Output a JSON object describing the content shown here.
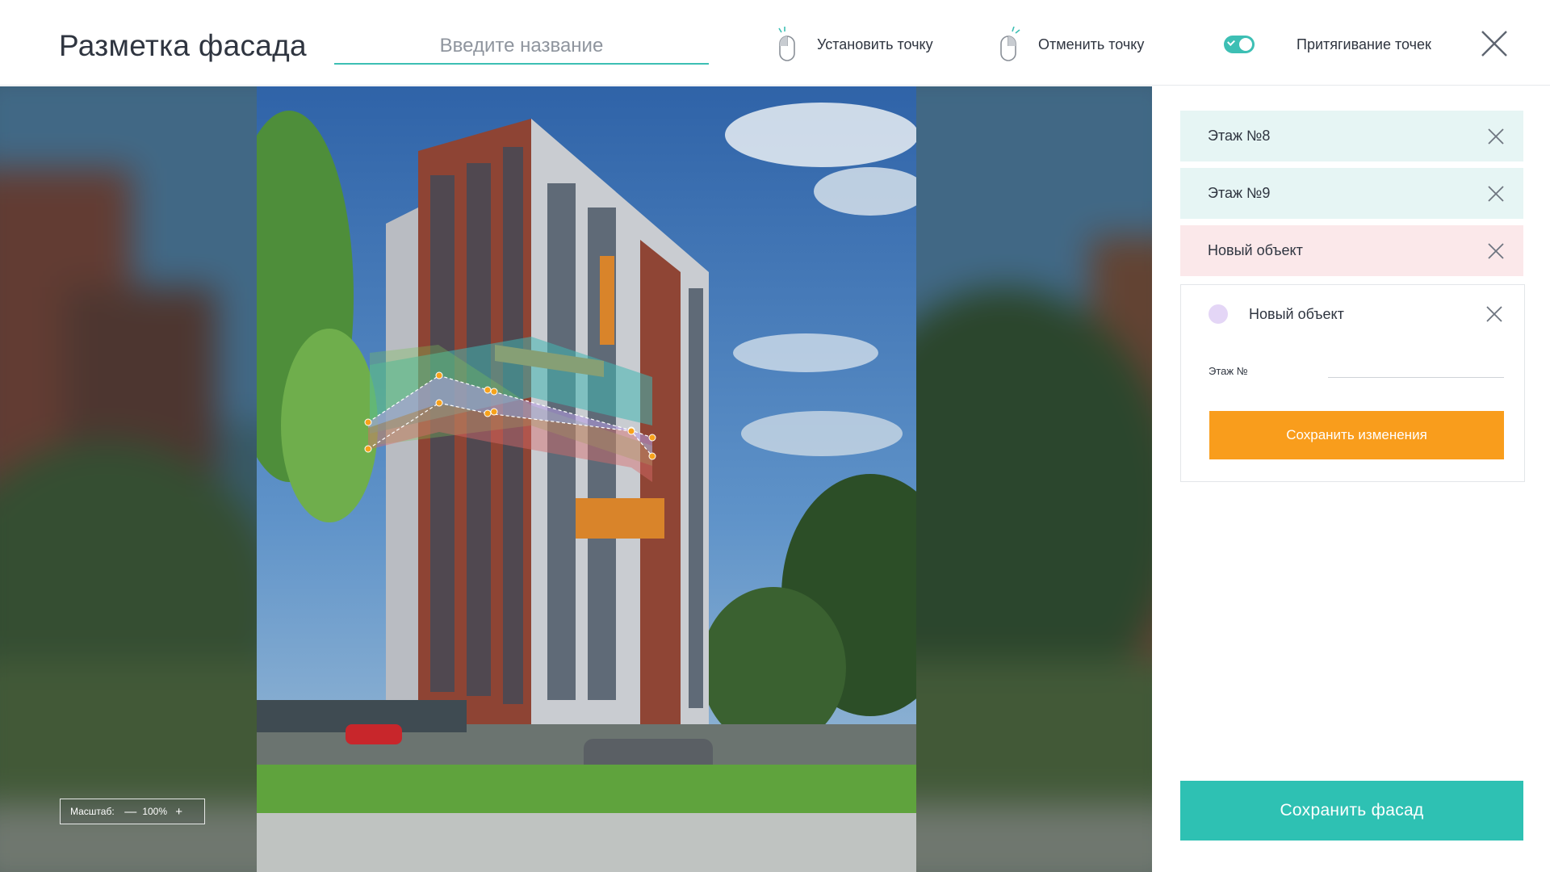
{
  "header": {
    "title": "Разметка фасада",
    "name_input": {
      "placeholder": "Введите название",
      "value": ""
    },
    "set_point_label": "Установить точку",
    "undo_point_label": "Отменить точку",
    "snap_label": "Притягивание точек",
    "snap_enabled": true
  },
  "viewer": {
    "zoom_label": "Масштаб:",
    "zoom_minus": "—",
    "zoom_value": "100%",
    "zoom_plus": "+"
  },
  "sidebar": {
    "objects": [
      {
        "label": "Этаж №8",
        "state": "saved"
      },
      {
        "label": "Этаж №9",
        "state": "saved"
      },
      {
        "label": "Новый объект",
        "state": "selected"
      }
    ],
    "editor": {
      "title": "Новый объект",
      "color": "#e4d6f6",
      "floor_label": "Этаж №",
      "floor_value": "",
      "save_button": "Сохранить изменения"
    },
    "save_facade_button": "Сохранить фасад"
  },
  "colors": {
    "accent_teal": "#2ec1b3",
    "accent_orange": "#f99d1c",
    "row_teal": "#e6f5f4",
    "row_pink": "#fbe8ea"
  }
}
